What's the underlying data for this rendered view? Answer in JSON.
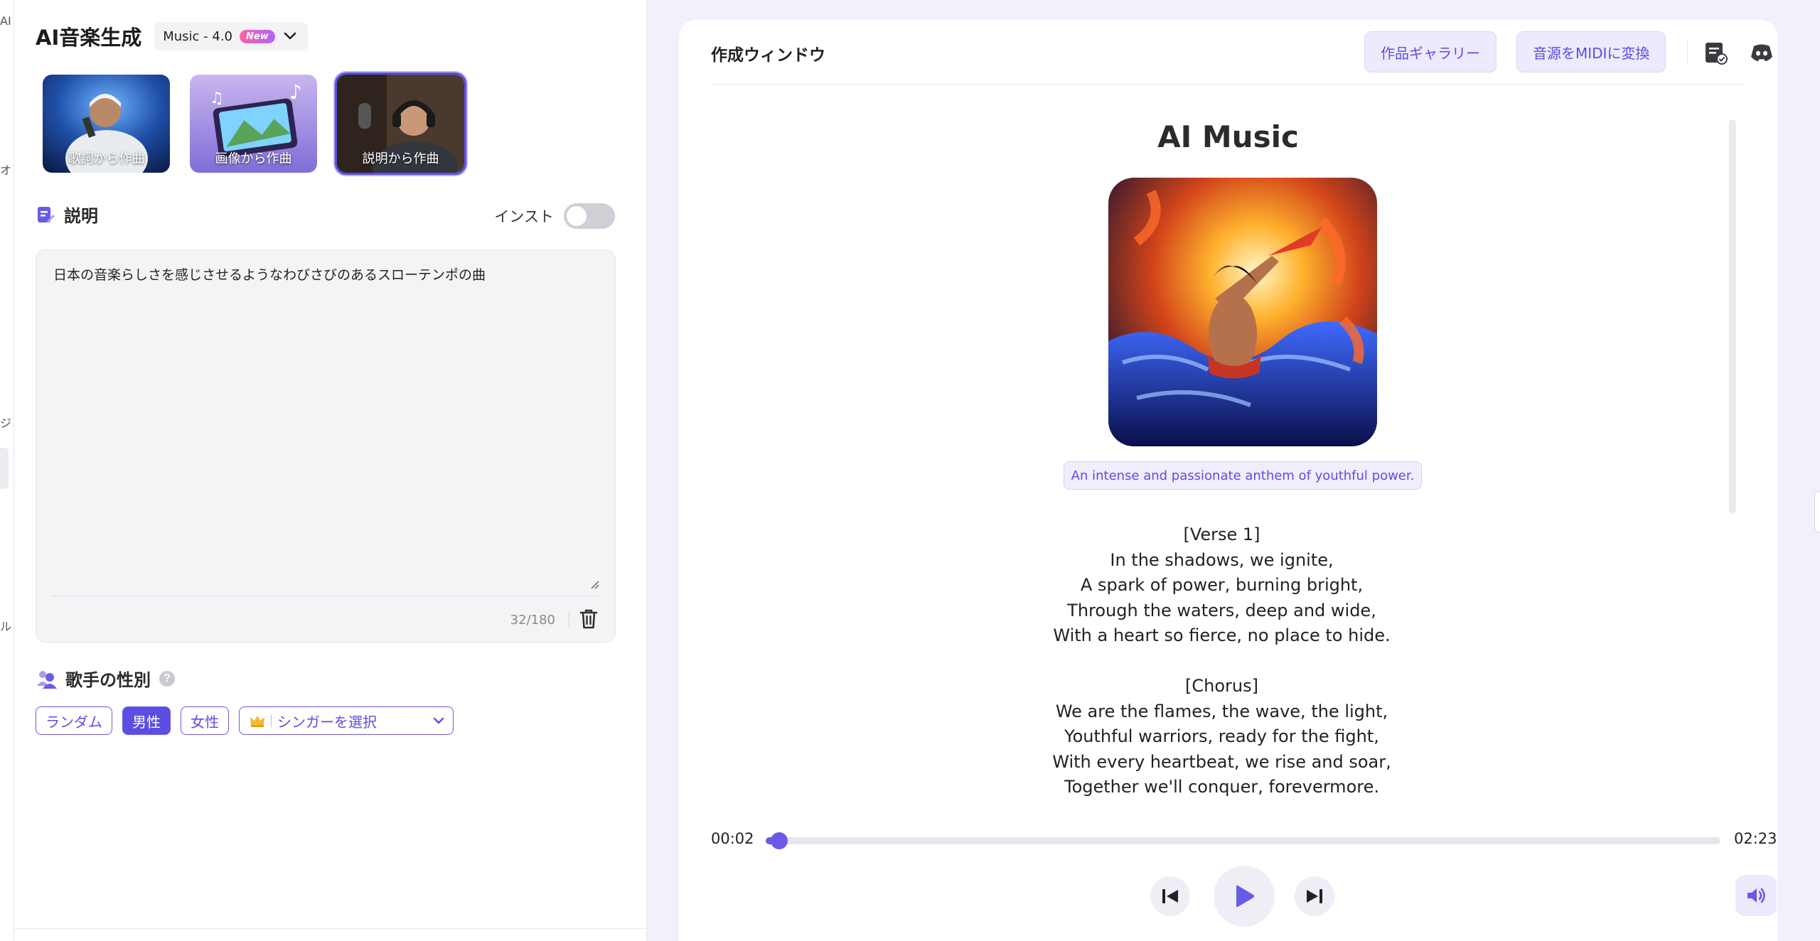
{
  "edge": {
    "frag1": "AI",
    "frag2": "オ",
    "frag3": "ジ",
    "frag4": "ル"
  },
  "left": {
    "app_title": "AI音楽生成",
    "model": {
      "name": "Music - 4.0",
      "badge": "New"
    },
    "modes": [
      {
        "label": "歌詞から作曲",
        "selected": false
      },
      {
        "label": "画像から作曲",
        "selected": false
      },
      {
        "label": "説明から作曲",
        "selected": true
      }
    ],
    "description": {
      "section_title": "説明",
      "instrumental_label": "インスト",
      "instrumental_on": false,
      "text": "日本の音楽らしさを感じさせるようなわびさびのあるスローテンポの曲",
      "char_count": "32/180"
    },
    "gender": {
      "section_title": "歌手の性別",
      "options": [
        "ランダム",
        "男性",
        "女性"
      ],
      "selected": "男性",
      "singer_select": "シンガーを選択"
    }
  },
  "right": {
    "title": "作成ウィンドウ",
    "gallery_button": "作品ギャラリー",
    "midi_button": "音源をMIDIに変換",
    "song": {
      "title": "AI Music",
      "tagline": "An intense and passionate anthem of youthful power.",
      "lyrics": {
        "verse_tag": "[Verse 1]",
        "verse": [
          "In the shadows, we ignite,",
          "A spark of power, burning bright,",
          "Through the waters, deep and wide,",
          "With a heart so fierce, no place to hide."
        ],
        "chorus_tag": "[Chorus]",
        "chorus": [
          "We are the flames, the wave, the light,",
          "Youthful warriors, ready for the fight,",
          "With every heartbeat, we rise and soar,",
          "Together we'll conquer, forevermore."
        ]
      }
    },
    "player": {
      "current_time": "00:02",
      "total_time": "02:23",
      "progress_fraction": 0.014
    }
  },
  "colors": {
    "accent": "#5b4ee0",
    "accent_light": "#eceafc",
    "badge_gradient_start": "#ff5ea8",
    "badge_gradient_end": "#b063ff"
  }
}
